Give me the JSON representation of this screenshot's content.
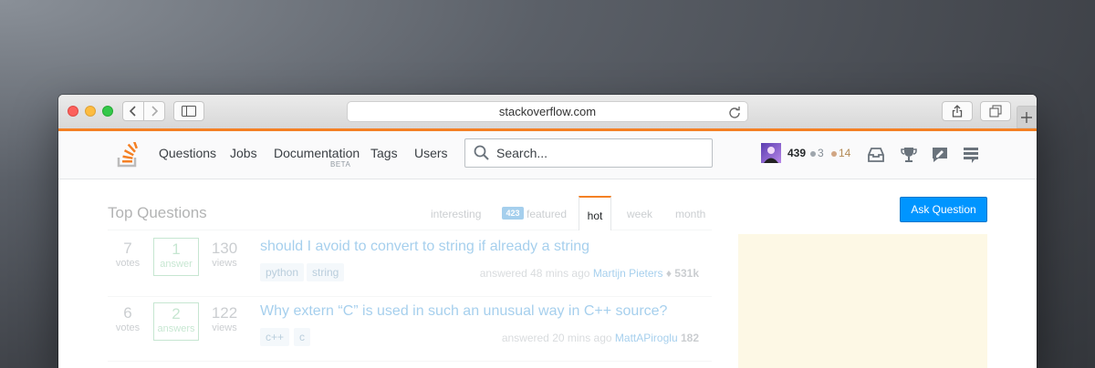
{
  "browser": {
    "url": "stackoverflow.com"
  },
  "header": {
    "nav": [
      "Questions",
      "Jobs",
      "Documentation",
      "Tags",
      "Users"
    ],
    "nav_badge": "BETA",
    "search_placeholder": "Search...",
    "reputation": "439",
    "silver_badges": "3",
    "bronze_badges": "14",
    "colors": {
      "accent": "#f48024",
      "silver": "#9fa6ad",
      "bronze": "#d1a684"
    }
  },
  "main": {
    "title": "Top Questions",
    "tabs": [
      "interesting",
      "featured",
      "hot",
      "week",
      "month"
    ],
    "featured_count": "423",
    "active_tab": "hot",
    "ask_button": "Ask Question"
  },
  "questions": [
    {
      "votes": "7",
      "votes_label": "votes",
      "answers": "1",
      "answers_label": "answer",
      "views": "130",
      "views_label": "views",
      "title": "should I avoid to convert to string if already a string",
      "tags": [
        "python",
        "string"
      ],
      "meta_action": "answered 48 mins ago",
      "user": "Martijn Pieters",
      "rep": "♦ 531k"
    },
    {
      "votes": "6",
      "votes_label": "votes",
      "answers": "2",
      "answers_label": "answers",
      "views": "122",
      "views_label": "views",
      "title": "Why extern “C” is used in such an unusual way in C++ source?",
      "tags": [
        "c++",
        "c"
      ],
      "meta_action": "answered 20 mins ago",
      "user": "MattAPiroglu",
      "rep": "182"
    }
  ]
}
